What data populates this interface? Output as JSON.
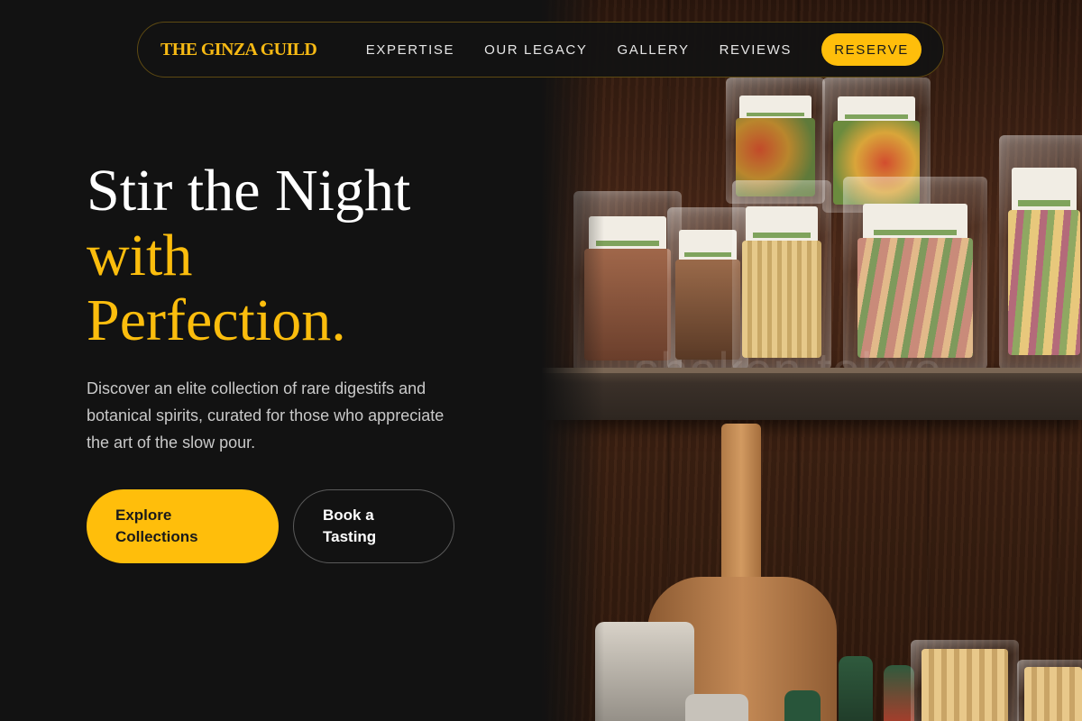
{
  "nav": {
    "brand": "THE GINZA GUILD",
    "links": [
      {
        "label": "EXPERTISE"
      },
      {
        "label": "OUR LEGACY"
      },
      {
        "label": "GALLERY"
      },
      {
        "label": "REVIEWS"
      }
    ],
    "cta": "RESERVE"
  },
  "hero": {
    "title_line1": "Stir the Night",
    "title_line2": "with",
    "title_line3": "Perfection.",
    "description": "Discover an elite collection of rare digestifs and botanical spirits, curated for those who appreciate the art of the slow pour.",
    "primary_button": "Explore Collections",
    "secondary_button": "Book a Tasting"
  },
  "photo": {
    "watermark": "shaken.tokyo"
  },
  "colors": {
    "background": "#121212",
    "accent": "#FFBE0B",
    "text": "#FFFFFF",
    "muted_text": "#C9C9C9"
  }
}
